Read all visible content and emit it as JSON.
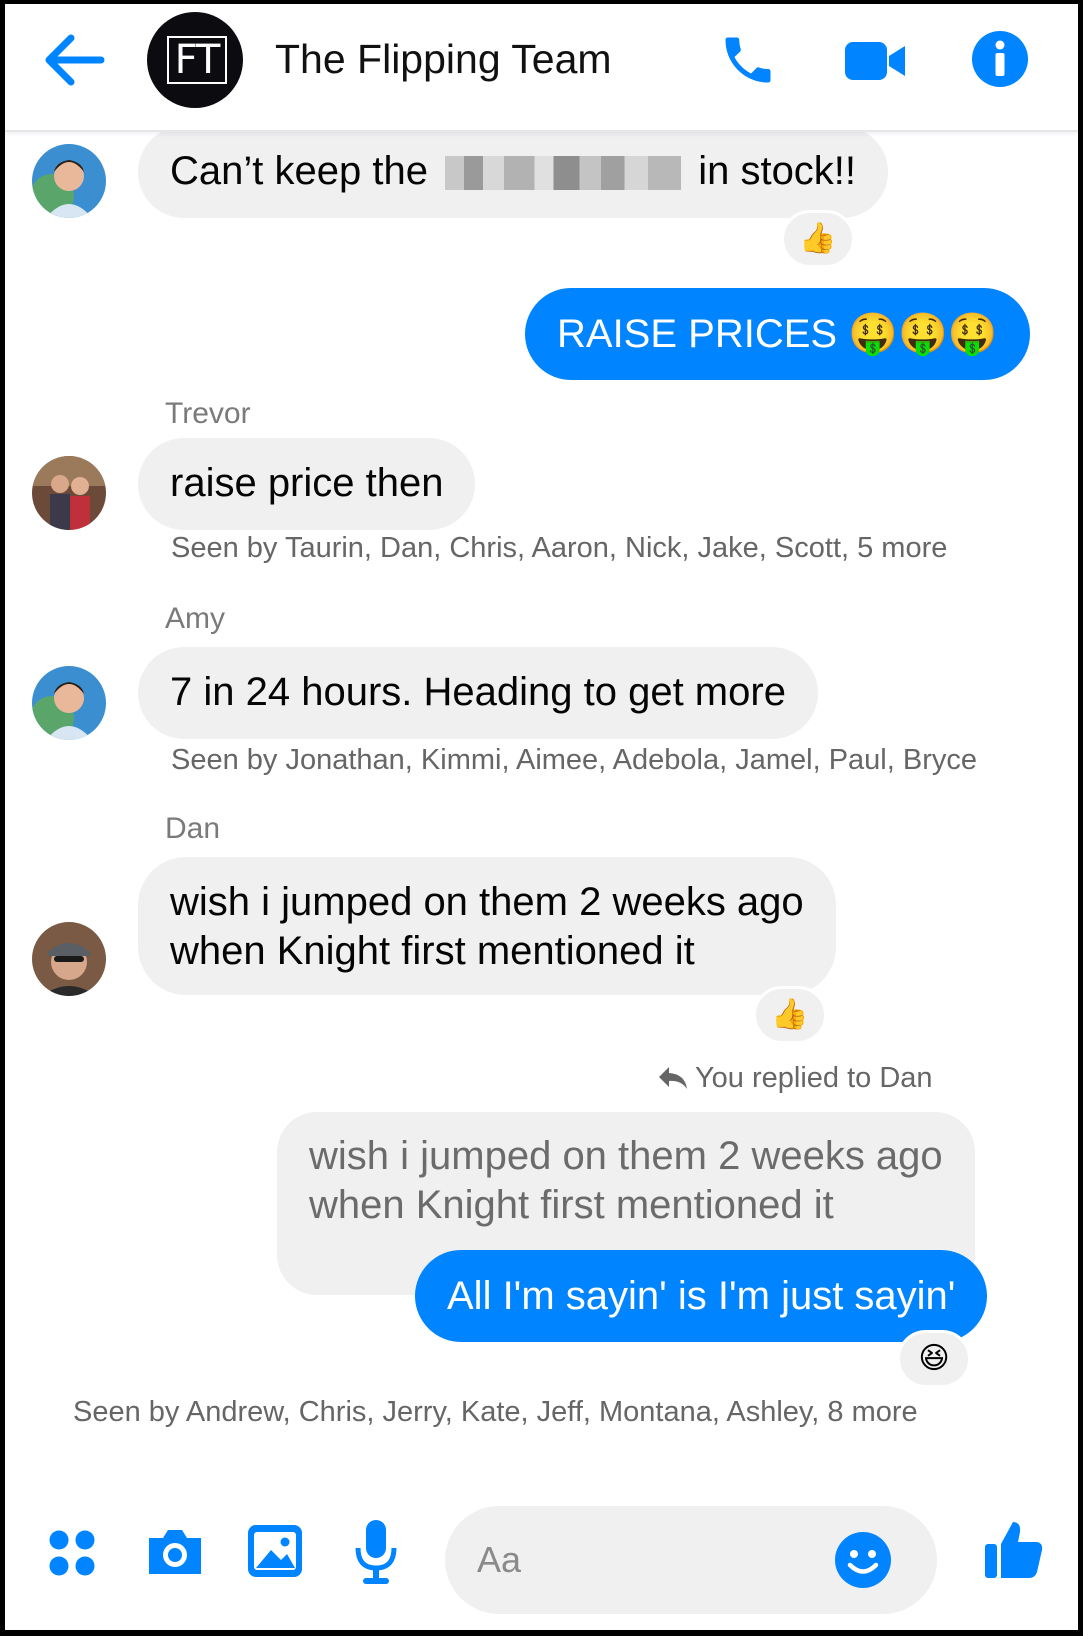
{
  "header": {
    "group_initials": "FT",
    "title": "The Flipping Team"
  },
  "messages": {
    "m1": {
      "text_before": "Can’t keep the",
      "text_after": "in stock!!",
      "reaction": "👍"
    },
    "m2": {
      "text": "RAISE PRICES 🤑🤑🤑"
    },
    "m3": {
      "sender": "Trevor",
      "text": "raise price then",
      "seen": "Seen by Taurin, Dan, Chris, Aaron, Nick, Jake, Scott, 5 more"
    },
    "m4": {
      "sender": "Amy",
      "text": "7 in 24 hours. Heading to get more",
      "seen": "Seen by Jonathan, Kimmi, Aimee, Adebola, Jamel, Paul, Bryce"
    },
    "m5": {
      "sender": "Dan",
      "line1": "wish i jumped on them 2 weeks ago",
      "line2": "when Knight first mentioned it",
      "reaction": "👍"
    },
    "reply": {
      "label": "You replied to Dan",
      "quote_line1": "wish i jumped on them 2 weeks ago",
      "quote_line2": "when Knight first mentioned it",
      "text": "All I'm sayin' is I'm just sayin'",
      "reaction": "😆"
    },
    "final_seen": "Seen by Andrew, Chris, Jerry, Kate, Jeff, Montana, Ashley, 8 more"
  },
  "composer": {
    "placeholder": "Aa"
  },
  "colors": {
    "accent": "#0084ff",
    "bubble_in": "#f0f0f0"
  },
  "icons": [
    "back-arrow-icon",
    "phone-icon",
    "video-icon",
    "info-icon",
    "apps-icon",
    "camera-icon",
    "image-icon",
    "microphone-icon",
    "emoji-icon",
    "like-icon"
  ]
}
